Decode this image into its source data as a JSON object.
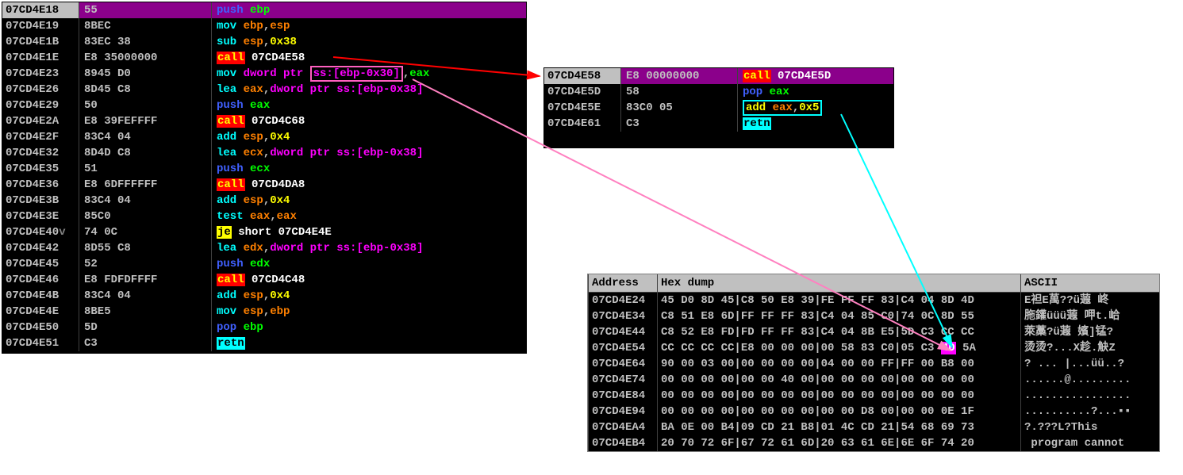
{
  "main_panel": {
    "rows": [
      {
        "addr": "07CD4E18",
        "bytes": "55",
        "sel": true,
        "parts": [
          {
            "t": "push",
            "c": "c-blue"
          },
          {
            "t": " ",
            "c": ""
          },
          {
            "t": "ebp",
            "c": "c-green"
          }
        ]
      },
      {
        "addr": "07CD4E19",
        "bytes": "8BEC",
        "parts": [
          {
            "t": "mov ",
            "c": "c-cyan"
          },
          {
            "t": "ebp",
            "c": "c-orange"
          },
          {
            "t": ",",
            "c": "c-silver"
          },
          {
            "t": "esp",
            "c": "c-orange"
          }
        ]
      },
      {
        "addr": "07CD4E1B",
        "bytes": "83EC 38",
        "parts": [
          {
            "t": "sub ",
            "c": "c-cyan"
          },
          {
            "t": "esp",
            "c": "c-orange"
          },
          {
            "t": ",",
            "c": "c-silver"
          },
          {
            "t": "0x38",
            "c": "c-yellow"
          }
        ]
      },
      {
        "addr": "07CD4E1E",
        "bytes": "E8 35000000",
        "parts": [
          {
            "t": "call",
            "c": "bg-red"
          },
          {
            "t": " ",
            "c": ""
          },
          {
            "t": "07CD4E58",
            "c": "c-white"
          }
        ]
      },
      {
        "addr": "07CD4E23",
        "bytes": "8945 D0",
        "parts": [
          {
            "t": "mov ",
            "c": "c-cyan"
          },
          {
            "t": "dword ptr ",
            "c": "c-magenta"
          },
          {
            "t": "ss:[ebp-0x30]",
            "c": "c-magenta",
            "box": "pink"
          },
          {
            "t": ",",
            "c": "c-silver"
          },
          {
            "t": "eax",
            "c": "c-green"
          }
        ]
      },
      {
        "addr": "07CD4E26",
        "bytes": "8D45 C8",
        "parts": [
          {
            "t": "lea ",
            "c": "c-cyan"
          },
          {
            "t": "eax",
            "c": "c-orange"
          },
          {
            "t": ",",
            "c": "c-silver"
          },
          {
            "t": "dword ptr ss:[ebp-0x38]",
            "c": "c-magenta"
          }
        ]
      },
      {
        "addr": "07CD4E29",
        "bytes": "50",
        "parts": [
          {
            "t": "push",
            "c": "c-blue"
          },
          {
            "t": " ",
            "c": ""
          },
          {
            "t": "eax",
            "c": "c-green"
          }
        ]
      },
      {
        "addr": "07CD4E2A",
        "bytes": "E8 39FEFFFF",
        "parts": [
          {
            "t": "call",
            "c": "bg-red"
          },
          {
            "t": " ",
            "c": ""
          },
          {
            "t": "07CD4C68",
            "c": "c-white"
          }
        ]
      },
      {
        "addr": "07CD4E2F",
        "bytes": "83C4 04",
        "parts": [
          {
            "t": "add ",
            "c": "c-cyan"
          },
          {
            "t": "esp",
            "c": "c-orange"
          },
          {
            "t": ",",
            "c": "c-silver"
          },
          {
            "t": "0x4",
            "c": "c-yellow"
          }
        ]
      },
      {
        "addr": "07CD4E32",
        "bytes": "8D4D C8",
        "parts": [
          {
            "t": "lea ",
            "c": "c-cyan"
          },
          {
            "t": "ecx",
            "c": "c-orange"
          },
          {
            "t": ",",
            "c": "c-silver"
          },
          {
            "t": "dword ptr ss:[ebp-0x38]",
            "c": "c-magenta"
          }
        ]
      },
      {
        "addr": "07CD4E35",
        "bytes": "51",
        "parts": [
          {
            "t": "push",
            "c": "c-blue"
          },
          {
            "t": " ",
            "c": ""
          },
          {
            "t": "ecx",
            "c": "c-green"
          }
        ]
      },
      {
        "addr": "07CD4E36",
        "bytes": "E8 6DFFFFFF",
        "parts": [
          {
            "t": "call",
            "c": "bg-red"
          },
          {
            "t": " ",
            "c": ""
          },
          {
            "t": "07CD4DA8",
            "c": "c-white"
          }
        ]
      },
      {
        "addr": "07CD4E3B",
        "bytes": "83C4 04",
        "parts": [
          {
            "t": "add ",
            "c": "c-cyan"
          },
          {
            "t": "esp",
            "c": "c-orange"
          },
          {
            "t": ",",
            "c": "c-silver"
          },
          {
            "t": "0x4",
            "c": "c-yellow"
          }
        ]
      },
      {
        "addr": "07CD4E3E",
        "bytes": "85C0",
        "parts": [
          {
            "t": "test ",
            "c": "c-cyan"
          },
          {
            "t": "eax",
            "c": "c-orange"
          },
          {
            "t": ",",
            "c": "c-silver"
          },
          {
            "t": "eax",
            "c": "c-orange"
          }
        ]
      },
      {
        "addr": "07CD4E40",
        "bytes": "74 0C",
        "mark": "v",
        "parts": [
          {
            "t": "je",
            "c": "bg-yellow"
          },
          {
            "t": " short ",
            "c": "c-white"
          },
          {
            "t": "07CD4E4E",
            "c": "c-white"
          }
        ]
      },
      {
        "addr": "07CD4E42",
        "bytes": "8D55 C8",
        "parts": [
          {
            "t": "lea ",
            "c": "c-cyan"
          },
          {
            "t": "edx",
            "c": "c-orange"
          },
          {
            "t": ",",
            "c": "c-silver"
          },
          {
            "t": "dword ptr ss:[ebp-0x38]",
            "c": "c-magenta"
          }
        ]
      },
      {
        "addr": "07CD4E45",
        "bytes": "52",
        "parts": [
          {
            "t": "push",
            "c": "c-blue"
          },
          {
            "t": " ",
            "c": ""
          },
          {
            "t": "edx",
            "c": "c-green"
          }
        ]
      },
      {
        "addr": "07CD4E46",
        "bytes": "E8 FDFDFFFF",
        "parts": [
          {
            "t": "call",
            "c": "bg-red"
          },
          {
            "t": " ",
            "c": ""
          },
          {
            "t": "07CD4C48",
            "c": "c-white"
          }
        ]
      },
      {
        "addr": "07CD4E4B",
        "bytes": "83C4 04",
        "parts": [
          {
            "t": "add ",
            "c": "c-cyan"
          },
          {
            "t": "esp",
            "c": "c-orange"
          },
          {
            "t": ",",
            "c": "c-silver"
          },
          {
            "t": "0x4",
            "c": "c-yellow"
          }
        ]
      },
      {
        "addr": "07CD4E4E",
        "bytes": "8BE5",
        "parts": [
          {
            "t": "mov ",
            "c": "c-cyan"
          },
          {
            "t": "esp",
            "c": "c-orange"
          },
          {
            "t": ",",
            "c": "c-silver"
          },
          {
            "t": "ebp",
            "c": "c-orange"
          }
        ]
      },
      {
        "addr": "07CD4E50",
        "bytes": "5D",
        "parts": [
          {
            "t": "pop",
            "c": "c-blue"
          },
          {
            "t": " ",
            "c": ""
          },
          {
            "t": "ebp",
            "c": "c-green"
          }
        ]
      },
      {
        "addr": "07CD4E51",
        "bytes": "C3",
        "parts": [
          {
            "t": "retn",
            "c": "bg-cyan"
          }
        ]
      }
    ]
  },
  "sub_panel": {
    "rows": [
      {
        "addr": "07CD4E58",
        "bytes": "E8 00000000",
        "sel": true,
        "parts": [
          {
            "t": "call",
            "c": "bg-red"
          },
          {
            "t": " ",
            "c": ""
          },
          {
            "t": "07CD4E5D",
            "c": "c-white"
          }
        ]
      },
      {
        "addr": "07CD4E5D",
        "bytes": "58",
        "parts": [
          {
            "t": "pop",
            "c": "c-blue"
          },
          {
            "t": " ",
            "c": ""
          },
          {
            "t": "eax",
            "c": "c-green"
          }
        ]
      },
      {
        "addr": "07CD4E5E",
        "bytes": "83C0 05",
        "parts": [
          {
            "t": "add ",
            "c": "c-yellow",
            "box": "cyan_open"
          },
          {
            "t": "eax",
            "c": "c-orange"
          },
          {
            "t": ",",
            "c": "c-silver"
          },
          {
            "t": "0x5",
            "c": "c-yellow",
            "box": "cyan_close"
          }
        ]
      },
      {
        "addr": "07CD4E61",
        "bytes": "C3",
        "parts": [
          {
            "t": "retn",
            "c": "bg-cyan"
          }
        ]
      }
    ]
  },
  "hexdump": {
    "headers": {
      "addr": "Address",
      "dump": "Hex dump",
      "ascii": "ASCII"
    },
    "rows": [
      {
        "addr": "07CD4E24",
        "hex": "45 D0 8D 45|C8 50 E8 39|FE FF FF 83|C4 04 8D 4D",
        "ascii": "E袒E萬??ü蕸 峂"
      },
      {
        "addr": "07CD4E34",
        "hex": "C8 51 E8 6D|FF FF FF 83|C4 04 85 C0|74 0C 8D 55",
        "ascii": "胣鑵üüü蕸 呷t.峆"
      },
      {
        "addr": "07CD4E44",
        "hex": "C8 52 E8 FD|FD FF FF 83|C4 04 8B E5|5D C3 CC CC",
        "ascii": "萊藁?ü蕸 嬪]锰?"
      },
      {
        "addr": "07CD4E54",
        "hex": "CC CC CC CC|E8 00 00 00|00 58 83 C0|05 C3 ",
        "hl": "4D",
        "hex2": " 5A",
        "ascii": "烫烫?...X趁.觖Z"
      },
      {
        "addr": "07CD4E64",
        "hex": "90 00 03 00|00 00 00 00|04 00 00 FF|FF 00 B8 00",
        "ascii": "? ... |...üü..?"
      },
      {
        "addr": "07CD4E74",
        "hex": "00 00 00 00|00 00 40 00|00 00 00 00|00 00 00 00",
        "ascii": "......@........."
      },
      {
        "addr": "07CD4E84",
        "hex": "00 00 00 00|00 00 00 00|00 00 00 00|00 00 00 00",
        "ascii": "................"
      },
      {
        "addr": "07CD4E94",
        "hex": "00 00 00 00|00 00 00 00|00 00 D8 00|00 00 0E 1F",
        "ascii": "..........?...▪▪"
      },
      {
        "addr": "07CD4EA4",
        "hex": "BA 0E 00 B4|09 CD 21 B8|01 4C CD 21|54 68 69 73",
        "ascii": "?.???L?This"
      },
      {
        "addr": "07CD4EB4",
        "hex": "20 70 72 6F|67 72 61 6D|20 63 61 6E|6E 6F 74 20",
        "ascii": " program cannot "
      }
    ]
  }
}
